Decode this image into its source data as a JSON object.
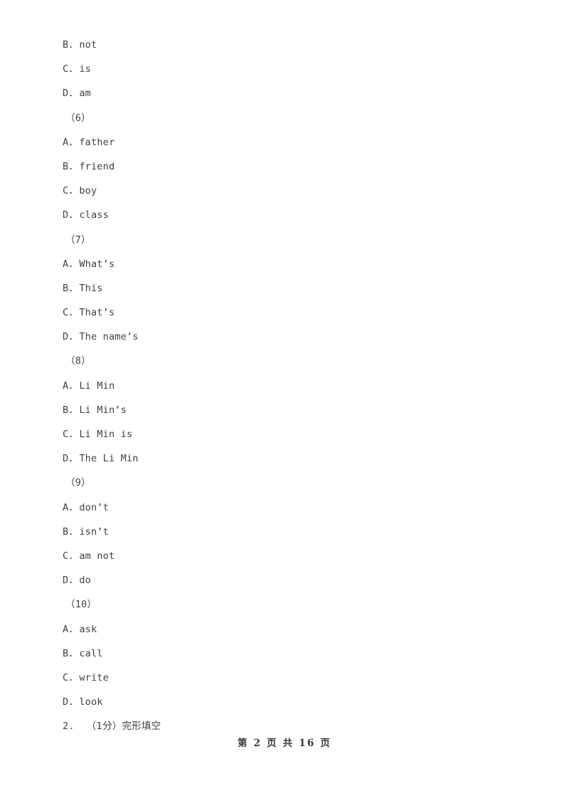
{
  "document": {
    "type": "exam-paper",
    "page_background": "#ffffff",
    "text_color": "#3f3f3f"
  },
  "body_lines": [
    {
      "kind": "option",
      "letter": "B",
      "separator": "．",
      "text": "not"
    },
    {
      "kind": "option",
      "letter": "C",
      "separator": "．",
      "text": "is"
    },
    {
      "kind": "option",
      "letter": "D",
      "separator": "．",
      "text": "am"
    },
    {
      "kind": "group",
      "text": "（6）"
    },
    {
      "kind": "option",
      "letter": "A",
      "separator": "．",
      "text": "father"
    },
    {
      "kind": "option",
      "letter": "B",
      "separator": "．",
      "text": "friend"
    },
    {
      "kind": "option",
      "letter": "C",
      "separator": "．",
      "text": "boy"
    },
    {
      "kind": "option",
      "letter": "D",
      "separator": "．",
      "text": "class"
    },
    {
      "kind": "group",
      "text": "（7）"
    },
    {
      "kind": "option",
      "letter": "A",
      "separator": "．",
      "text": "What’s"
    },
    {
      "kind": "option",
      "letter": "B",
      "separator": "．",
      "text": "This"
    },
    {
      "kind": "option",
      "letter": "C",
      "separator": "．",
      "text": "That’s"
    },
    {
      "kind": "option",
      "letter": "D",
      "separator": "．",
      "text": "The name’s"
    },
    {
      "kind": "group",
      "text": "（8）"
    },
    {
      "kind": "option",
      "letter": "A",
      "separator": "．",
      "text": "Li Min"
    },
    {
      "kind": "option",
      "letter": "B",
      "separator": "．",
      "text": "Li Min’s"
    },
    {
      "kind": "option",
      "letter": "C",
      "separator": "．",
      "text": "Li Min is"
    },
    {
      "kind": "option",
      "letter": "D",
      "separator": "．",
      "text": "The Li Min"
    },
    {
      "kind": "group",
      "text": "（9）"
    },
    {
      "kind": "option",
      "letter": "A",
      "separator": "．",
      "text": "don’t"
    },
    {
      "kind": "option",
      "letter": "B",
      "separator": "．",
      "text": "isn’t"
    },
    {
      "kind": "option",
      "letter": "C",
      "separator": "．",
      "text": "am not"
    },
    {
      "kind": "option",
      "letter": "D",
      "separator": "．",
      "text": "do"
    },
    {
      "kind": "group",
      "text": "（10）"
    },
    {
      "kind": "option",
      "letter": "A",
      "separator": "．",
      "text": "ask"
    },
    {
      "kind": "option",
      "letter": "B",
      "separator": "．",
      "text": "call"
    },
    {
      "kind": "option",
      "letter": "C",
      "separator": "．",
      "text": "write"
    },
    {
      "kind": "option",
      "letter": "D",
      "separator": "．",
      "text": "look"
    },
    {
      "kind": "question",
      "number": "2.",
      "score": "（1分）",
      "title": "完形填空"
    }
  ],
  "footer": {
    "text": "第 2 页 共 16 页",
    "current_page": "2",
    "total_pages": "16"
  }
}
